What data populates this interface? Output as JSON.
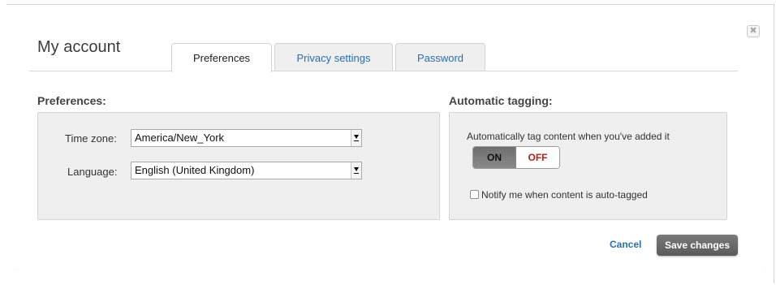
{
  "dialog": {
    "title": "My account",
    "close_symbol": "✖",
    "close_icon": "close-icon"
  },
  "tabs": [
    {
      "label": "Preferences",
      "active": true
    },
    {
      "label": "Privacy settings",
      "active": false
    },
    {
      "label": "Password",
      "active": false
    }
  ],
  "preferences": {
    "heading": "Preferences:",
    "timezone": {
      "label": "Time zone:",
      "value": "America/New_York"
    },
    "language": {
      "label": "Language:",
      "value": "English (United Kingdom)"
    }
  },
  "tagging": {
    "heading": "Automatic tagging:",
    "description": "Automatically tag content when you've added it",
    "toggle": {
      "on_label": "ON",
      "off_label": "OFF",
      "state": "ON"
    },
    "notify": {
      "label": "Notify me when content is auto-tagged",
      "checked": false
    }
  },
  "actions": {
    "cancel_label": "Cancel",
    "save_label": "Save changes"
  },
  "colors": {
    "link": "#2a6fb0",
    "off_text": "#b02020",
    "save_button": "#666666",
    "panel_bg": "#efefef"
  }
}
